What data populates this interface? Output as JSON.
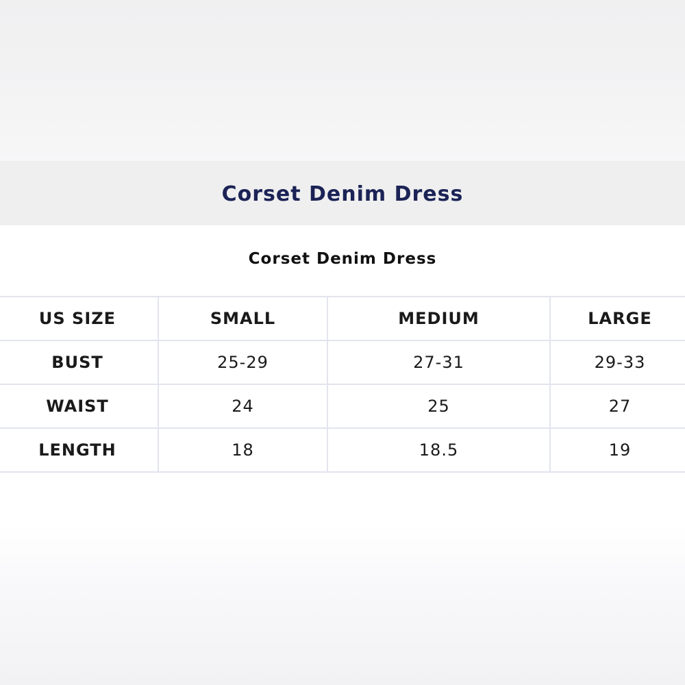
{
  "header": {
    "title": "Corset Denim Dress"
  },
  "table": {
    "title": "Corset Denim Dress",
    "columns": [
      "US SIZE",
      "SMALL",
      "MEDIUM",
      "LARGE"
    ],
    "rows": [
      {
        "label": "BUST",
        "values": [
          "25-29",
          "27-31",
          "29-33"
        ]
      },
      {
        "label": "WAIST",
        "values": [
          "24",
          "25",
          "27"
        ]
      },
      {
        "label": "LENGTH",
        "values": [
          "18",
          "18.5",
          "19"
        ]
      }
    ]
  },
  "colors": {
    "title": "#1b2356",
    "header_band": "#efefef",
    "table_border": "#e2e4ef"
  }
}
